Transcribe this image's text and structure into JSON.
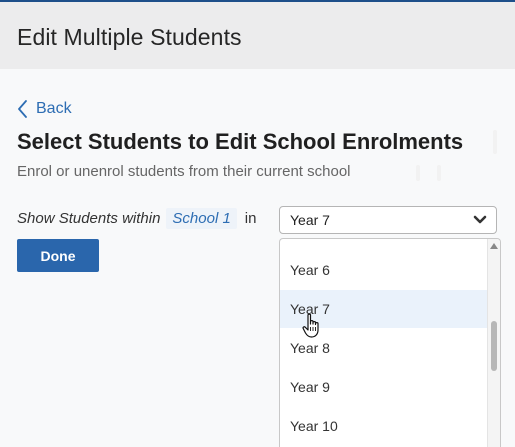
{
  "header": {
    "title": "Edit Multiple Students"
  },
  "nav": {
    "back_label": "Back"
  },
  "page": {
    "title": "Select Students to Edit School Enrolments",
    "subtitle": "Enrol or unenrol students from their current school"
  },
  "filter": {
    "label": "Show Students within",
    "school": "School 1",
    "in_label": "in",
    "selected_year": "Year 7"
  },
  "actions": {
    "done_label": "Done"
  },
  "dropdown": {
    "options": [
      "Year 6",
      "Year 7",
      "Year 8",
      "Year 9",
      "Year 10"
    ],
    "selected_index": 1
  },
  "icons": {
    "back": "chevron-left-icon",
    "select": "chevron-down-icon",
    "cursor": "hand-pointer-icon"
  },
  "colors": {
    "accent": "#2a66ac",
    "link": "#2d6db3",
    "header_bg": "#ececed",
    "top_bar": "#1e4f8a",
    "selected_option_bg": "#eaf2fb"
  }
}
